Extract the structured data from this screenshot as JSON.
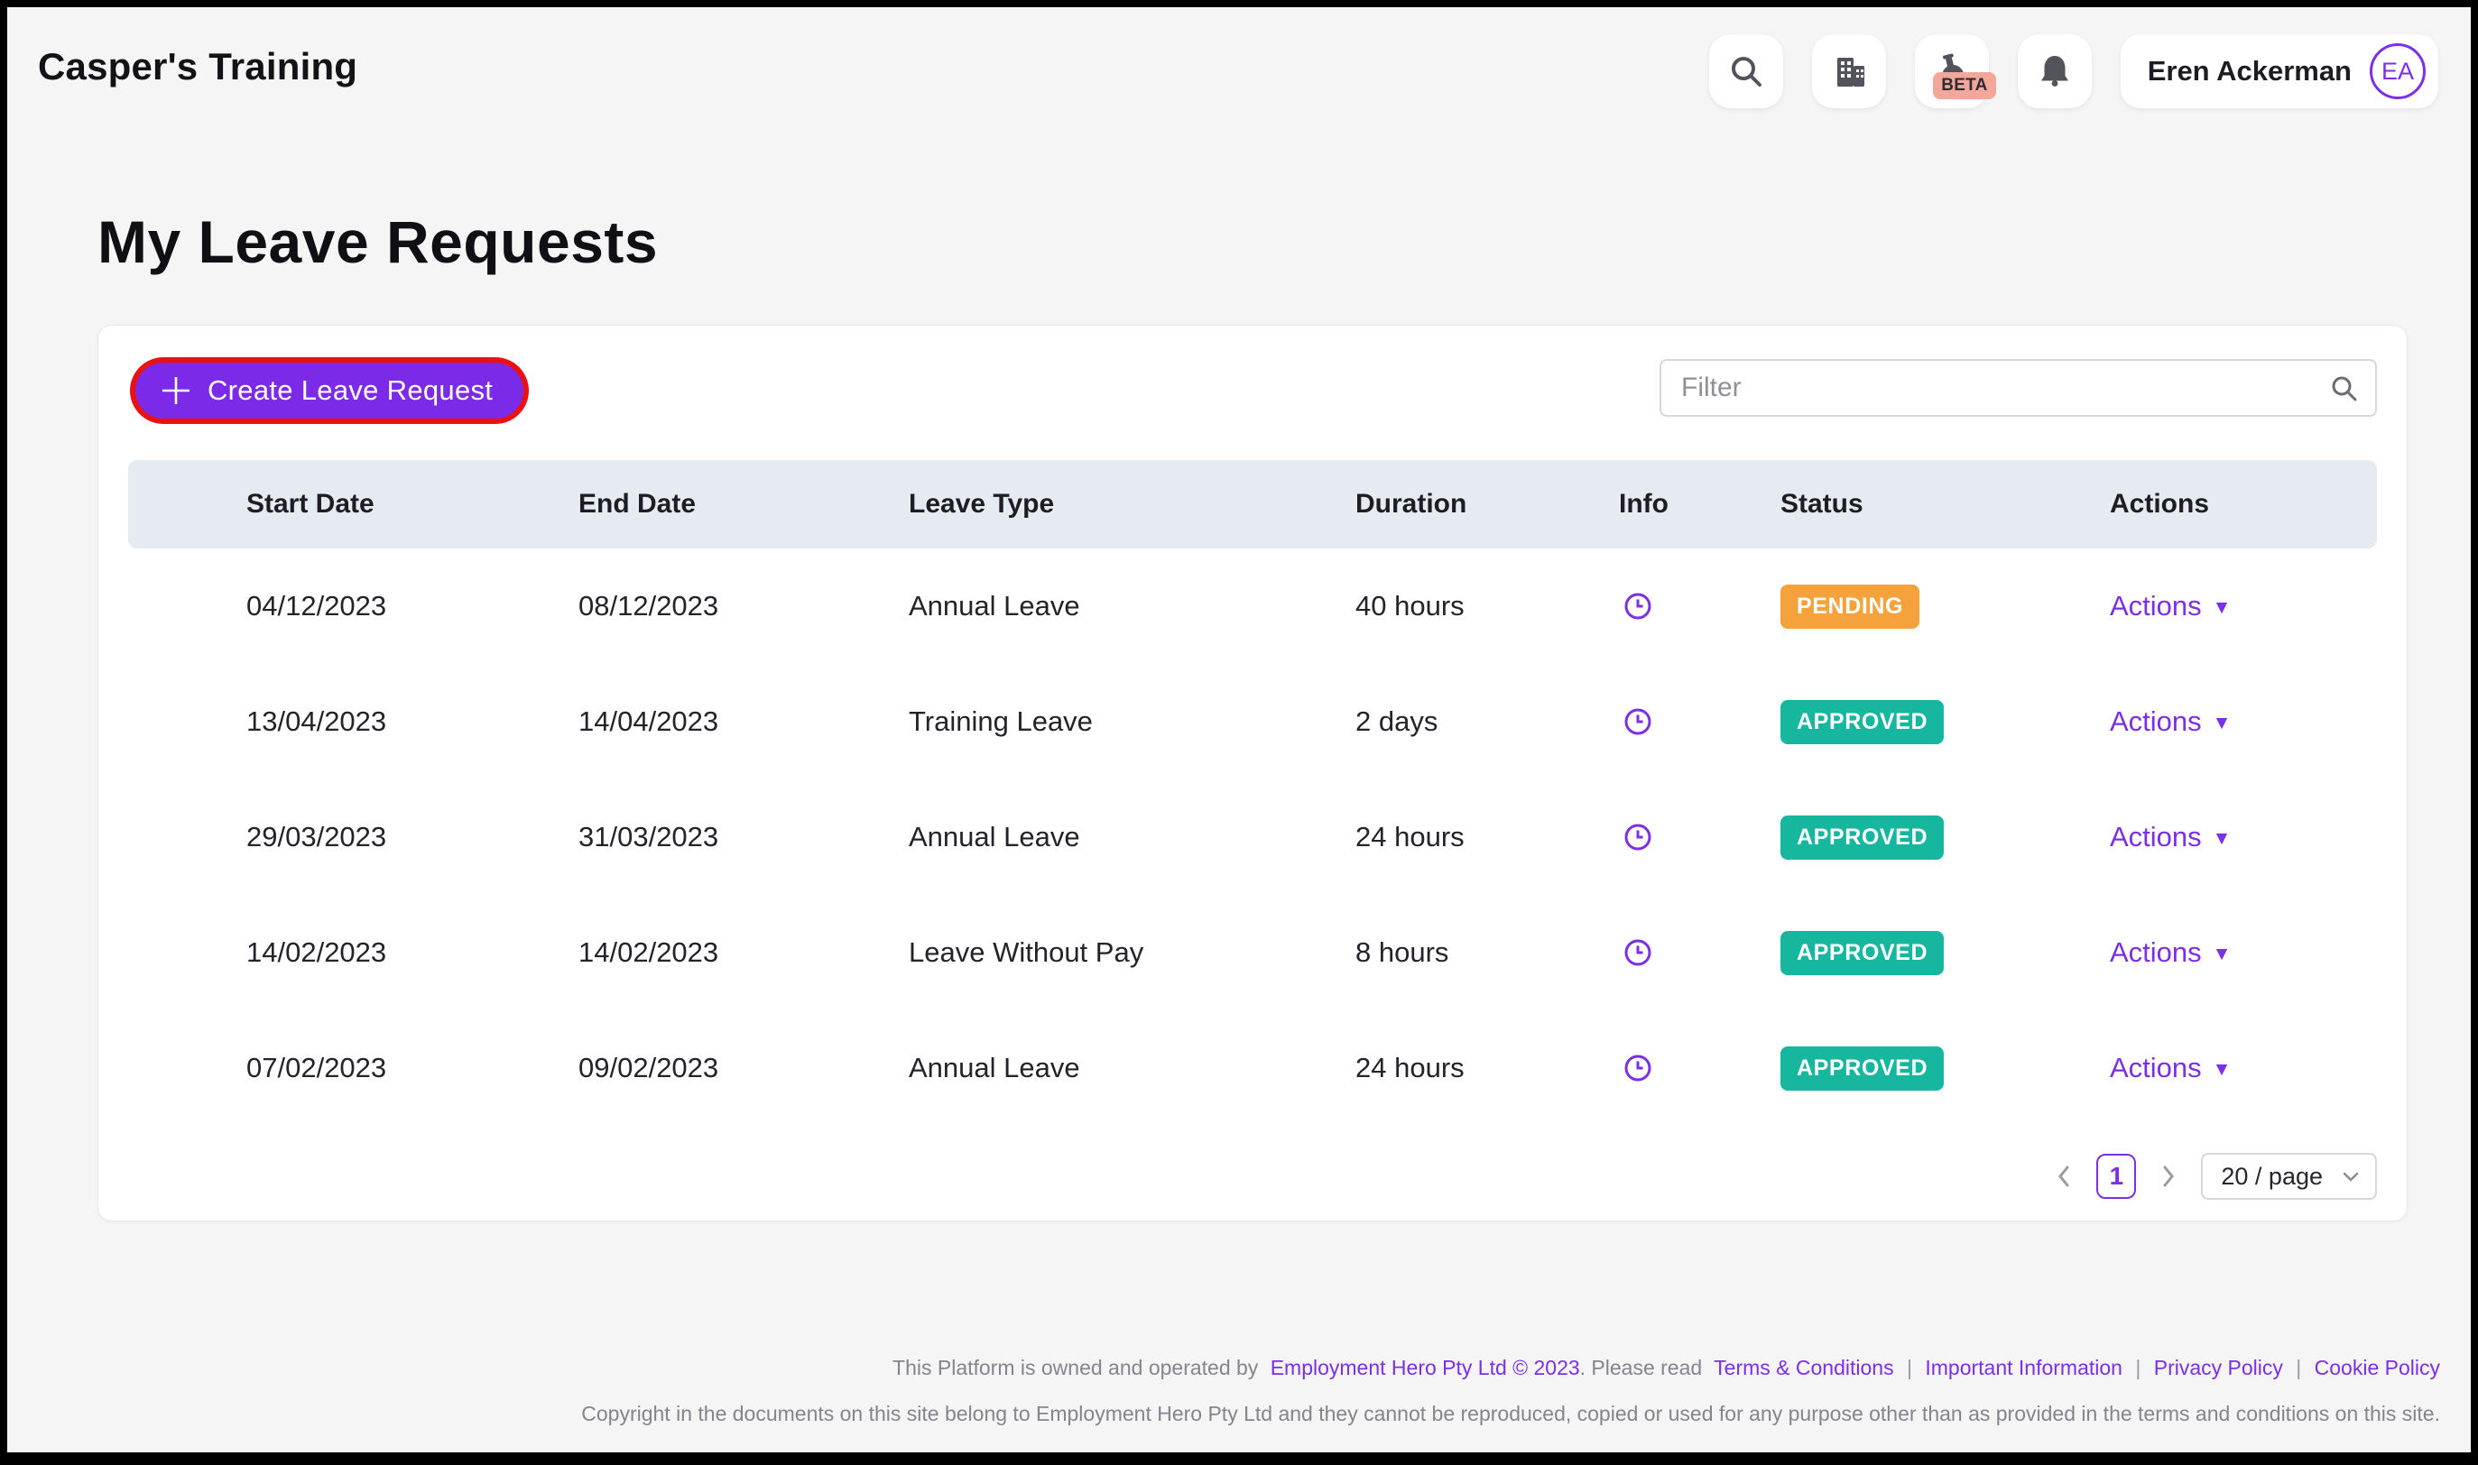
{
  "app": {
    "title": "Casper's Training"
  },
  "topbar": {
    "beta_badge": "BETA",
    "user": {
      "name": "Eren Ackerman",
      "initials": "EA"
    }
  },
  "page": {
    "title": "My Leave Requests"
  },
  "toolbar": {
    "create_button_label": "Create Leave Request",
    "filter_placeholder": "Filter"
  },
  "table": {
    "columns": [
      "Start Date",
      "End Date",
      "Leave Type",
      "Duration",
      "Info",
      "Status",
      "Actions"
    ],
    "actions_label": "Actions",
    "actions_caret": "▼",
    "status_colors": {
      "pending": "#f5a23c",
      "approved": "#16b79e"
    },
    "rows": [
      {
        "start_date": "04/12/2023",
        "end_date": "08/12/2023",
        "leave_type": "Annual Leave",
        "duration": "40 hours",
        "status": "PENDING",
        "status_color": "#f5a23c"
      },
      {
        "start_date": "13/04/2023",
        "end_date": "14/04/2023",
        "leave_type": "Training Leave",
        "duration": "2 days",
        "status": "APPROVED",
        "status_color": "#16b79e"
      },
      {
        "start_date": "29/03/2023",
        "end_date": "31/03/2023",
        "leave_type": "Annual Leave",
        "duration": "24 hours",
        "status": "APPROVED",
        "status_color": "#16b79e"
      },
      {
        "start_date": "14/02/2023",
        "end_date": "14/02/2023",
        "leave_type": "Leave Without Pay",
        "duration": "8 hours",
        "status": "APPROVED",
        "status_color": "#16b79e"
      },
      {
        "start_date": "07/02/2023",
        "end_date": "09/02/2023",
        "leave_type": "Annual Leave",
        "duration": "24 hours",
        "status": "APPROVED",
        "status_color": "#16b79e"
      }
    ]
  },
  "pagination": {
    "current_page": "1",
    "page_size_label": "20 / page"
  },
  "footer": {
    "prefix": "This Platform is owned and operated by",
    "company_link": "Employment Hero Pty Ltd © 2023",
    "middle": ". Please read",
    "separator": "|",
    "links": [
      "Terms & Conditions",
      "Important Information",
      "Privacy Policy",
      "Cookie Policy"
    ],
    "copyright": "Copyright in the documents on this site belong to Employment Hero Pty Ltd and they cannot be reproduced, copied or used for any purpose other than as provided in the terms and conditions on this site."
  },
  "colors": {
    "accent_purple": "#7b2fe6",
    "button_purple": "#7b2be8",
    "highlight_red": "#ec1111",
    "pending_orange": "#f5a23c",
    "approved_teal": "#16b79e",
    "table_header_bg": "#e6ebf2"
  }
}
